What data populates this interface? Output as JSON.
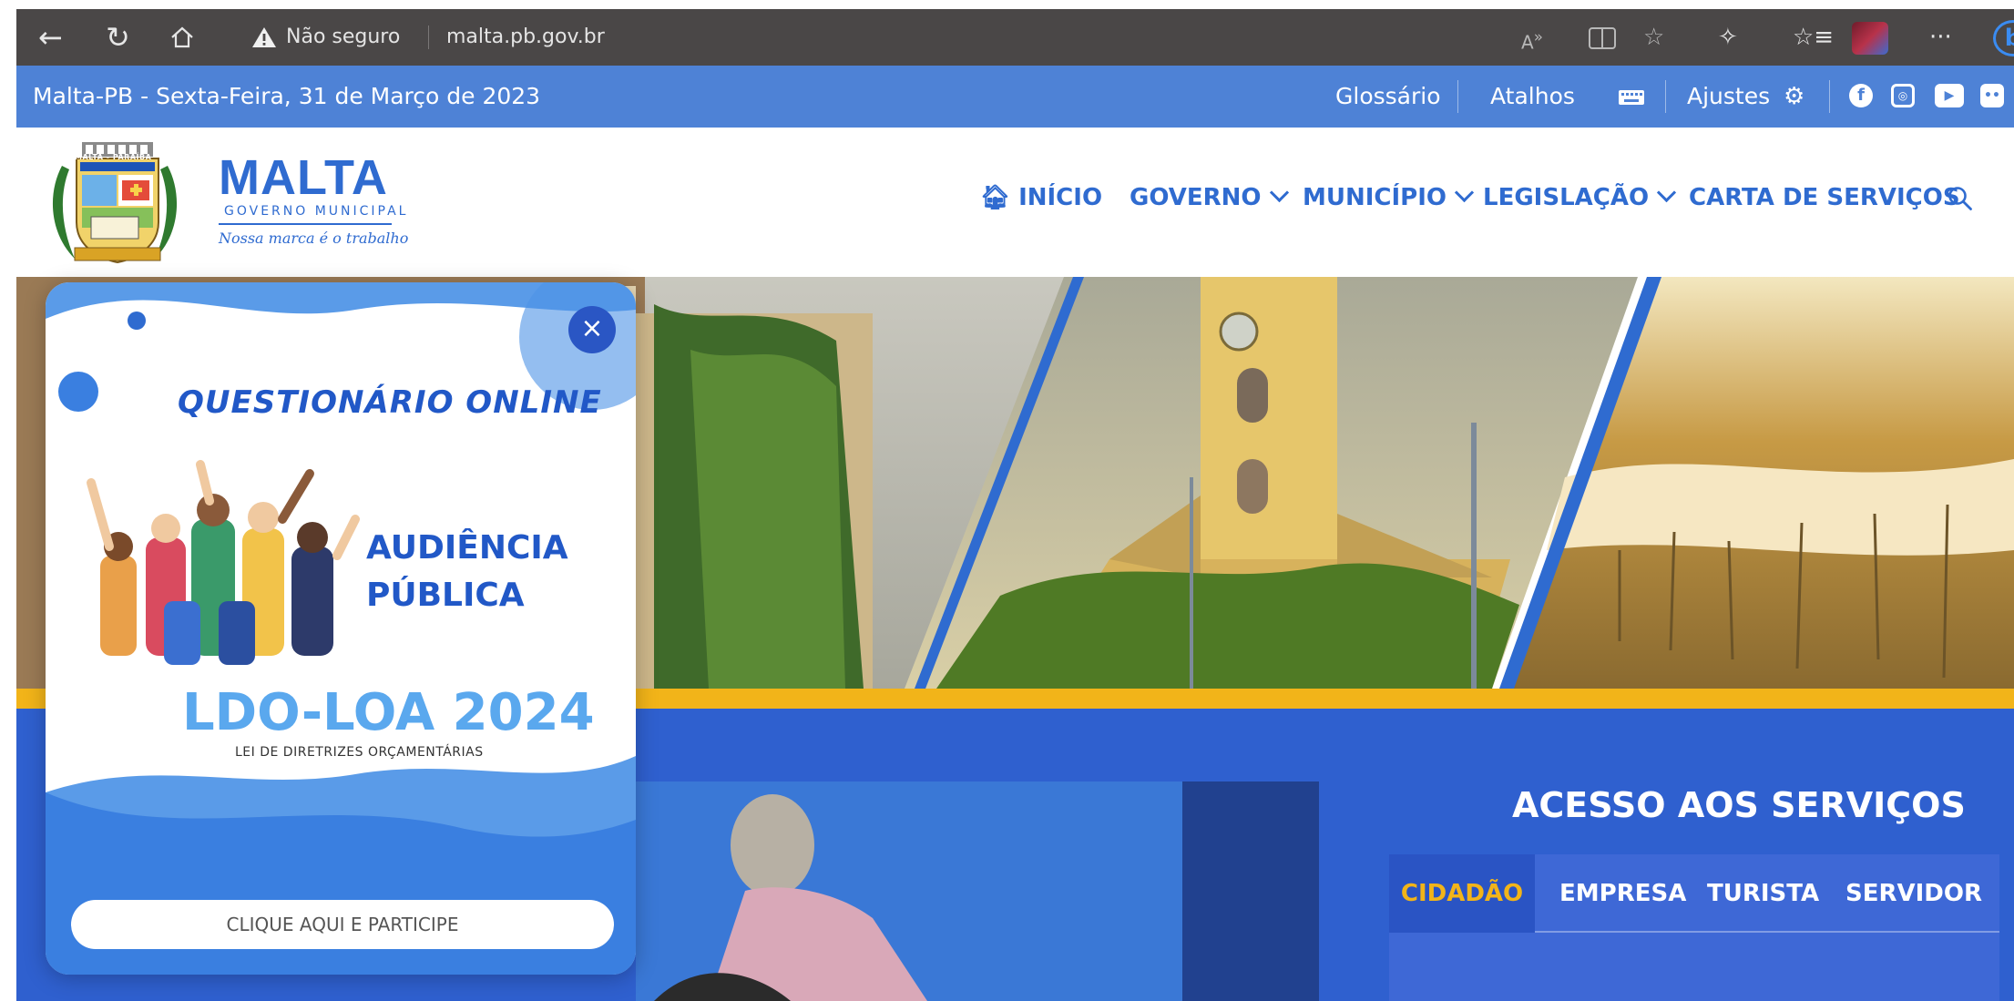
{
  "browser": {
    "security_label": "Não seguro",
    "url": "malta.pb.gov.br",
    "icons": [
      "back-arrow-icon",
      "refresh-icon",
      "home-icon",
      "warning-icon",
      "read-aloud-icon",
      "split-screen-icon",
      "favorite-icon",
      "extensions-icon",
      "favorites-list-icon",
      "more-icon",
      "copilot-icon"
    ],
    "menu_glyph": "···",
    "copilot_glyph": "b"
  },
  "topbar": {
    "date": "Malta-PB - Sexta-Feira, 31 de Março de 2023",
    "glossario": "Glossário",
    "atalhos": "Atalhos",
    "ajustes": "Ajustes",
    "social": [
      "facebook-icon",
      "instagram-icon",
      "youtube-icon",
      "flickr-icon"
    ]
  },
  "header": {
    "brand": "MALTA",
    "brand_sub": "GOVERNO MUNICIPAL",
    "slogan": "Nossa marca é o trabalho",
    "crest_label": "MALTA - PARAÍBA",
    "nav": {
      "inicio": "INÍCIO",
      "governo": "GOVERNO",
      "municipio": "MUNICÍPIO",
      "legislacao": "LEGISLAÇÃO",
      "carta": "CARTA DE SERVIÇOS"
    }
  },
  "popup": {
    "title": "QUESTIONÁRIO ONLINE",
    "audiencia_line1": "AUDIÊNCIA",
    "audiencia_line2": "PÚBLICA",
    "ldo": "LDO-LOA 2024",
    "lei": "LEI DE DIRETRIZES ORÇAMENTÁRIAS",
    "cta": "CLIQUE AQUI E PARTICIPE",
    "close_glyph": "×"
  },
  "services": {
    "title": "ACESSO AOS SERVIÇOS",
    "tabs": [
      "CIDADÃO",
      "EMPRESA",
      "TURISTA",
      "SERVIDOR"
    ],
    "active_tab": "CIDADÃO"
  },
  "colors": {
    "primary": "#2f6bd0",
    "topbar": "#4e82d6",
    "accent": "#f2b419",
    "services_bg": "#2f60cf"
  }
}
